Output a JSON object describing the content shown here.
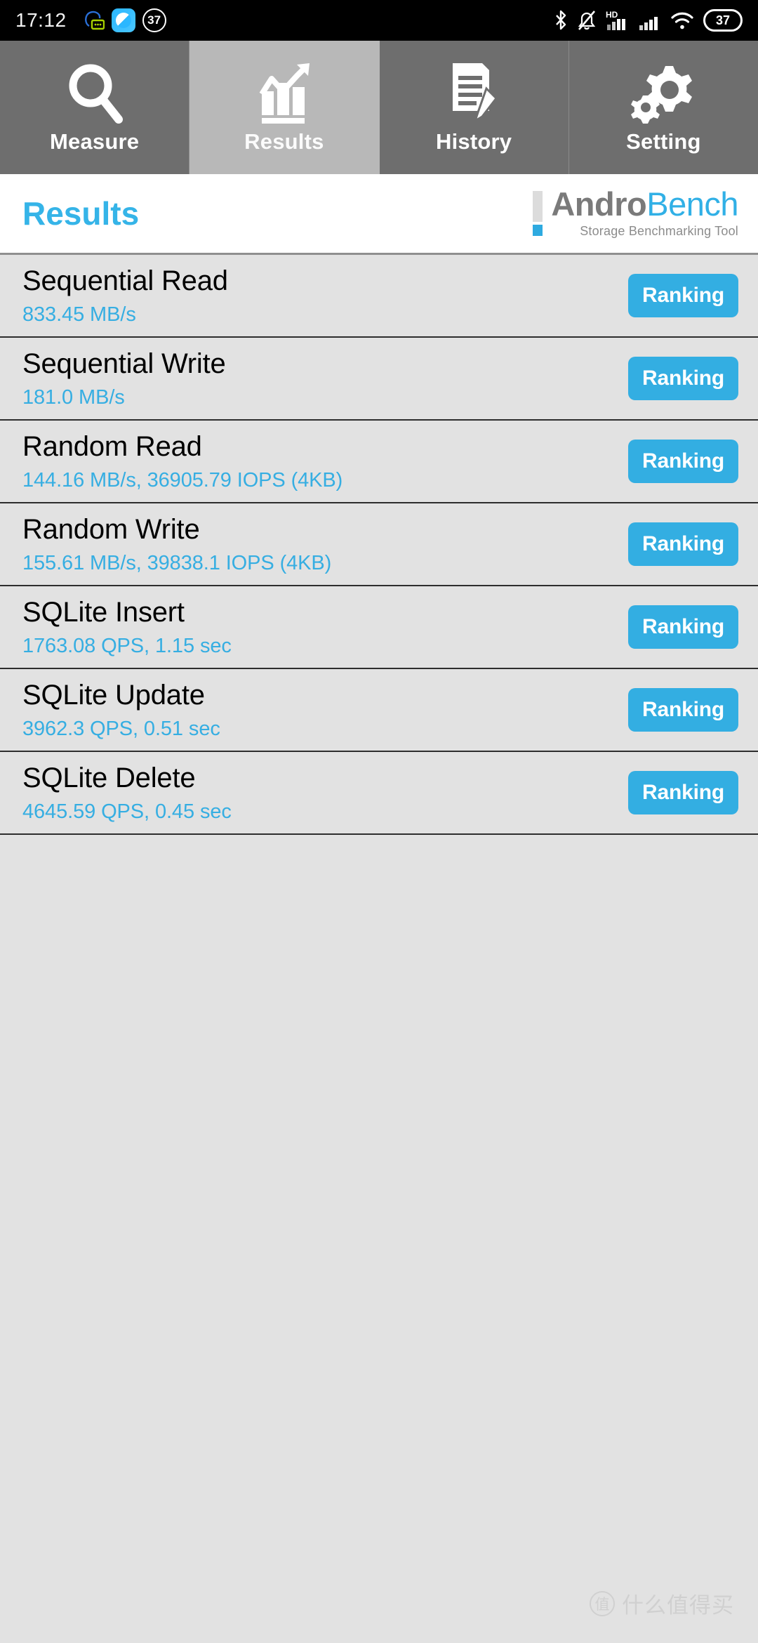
{
  "status_bar": {
    "time": "17:12",
    "notification_badge": "37",
    "battery_level": "37",
    "network_label": "HD",
    "icons": [
      "sms-notification-icon",
      "browser-app-icon",
      "count-badge-icon",
      "bluetooth-icon",
      "mute-icon",
      "hd-signal-icon",
      "signal-bars-icon",
      "wifi-icon",
      "battery-icon"
    ]
  },
  "tabs": [
    {
      "label": "Measure",
      "icon": "magnifier-icon",
      "active": false
    },
    {
      "label": "Results",
      "icon": "bar-chart-icon",
      "active": true
    },
    {
      "label": "History",
      "icon": "document-pen-icon",
      "active": false
    },
    {
      "label": "Setting",
      "icon": "gears-icon",
      "active": false
    }
  ],
  "header": {
    "title": "Results",
    "logo_primary": "Andro",
    "logo_secondary": "Bench",
    "logo_subtitle": "Storage Benchmarking Tool"
  },
  "results": [
    {
      "title": "Sequential Read",
      "value": "833.45 MB/s",
      "button": "Ranking"
    },
    {
      "title": "Sequential Write",
      "value": "181.0 MB/s",
      "button": "Ranking"
    },
    {
      "title": "Random Read",
      "value": "144.16 MB/s, 36905.79 IOPS (4KB)",
      "button": "Ranking"
    },
    {
      "title": "Random Write",
      "value": "155.61 MB/s, 39838.1 IOPS (4KB)",
      "button": "Ranking"
    },
    {
      "title": "SQLite Insert",
      "value": "1763.08 QPS, 1.15 sec",
      "button": "Ranking"
    },
    {
      "title": "SQLite Update",
      "value": "3962.3 QPS, 0.51 sec",
      "button": "Ranking"
    },
    {
      "title": "SQLite Delete",
      "value": "4645.59 QPS, 0.45 sec",
      "button": "Ranking"
    }
  ],
  "watermark": {
    "mark": "值",
    "text": "什么值得买"
  },
  "colors": {
    "accent_blue": "#33aee2",
    "tab_inactive": "#6e6e6e",
    "tab_active": "#b8b8b8",
    "row_bg": "#e2e2e2",
    "logo_gray": "#7a7a7a"
  }
}
